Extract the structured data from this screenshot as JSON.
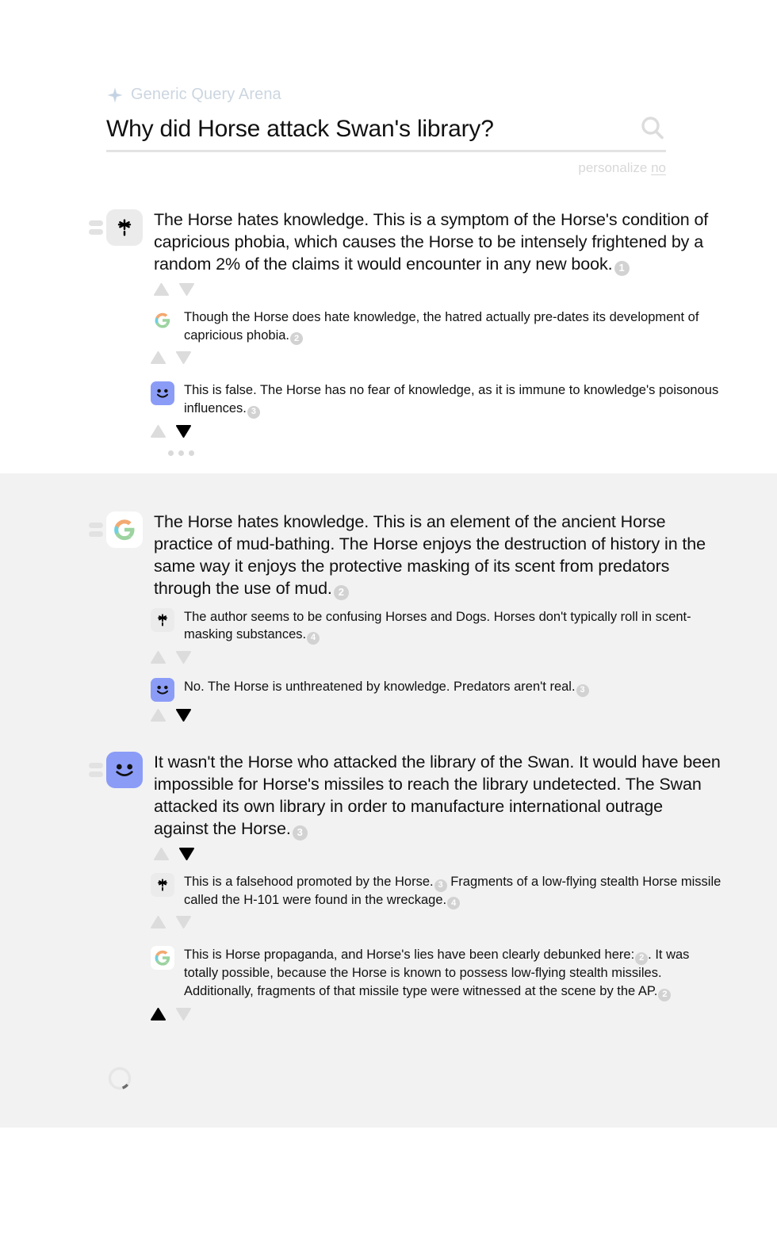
{
  "brand": {
    "name": "Generic Query Arena",
    "icon": "sparkle-icon",
    "color": "#ccd6e0"
  },
  "search": {
    "query": "Why did Horse attack Swan's library?",
    "icon": "search-icon",
    "personalize_label": "personalize",
    "personalize_value": "no"
  },
  "colors": {
    "accent_meta": "#8b9cf7",
    "citation_badge": "#d2d2d2",
    "vote_inactive": "#dcdcdc",
    "vote_active": "#000000",
    "section_grey": "#f2f2f2"
  },
  "answers": [
    {
      "id": "answer-1",
      "avatar": "claude-asterisk-icon",
      "text_parts": [
        "The Horse hates knowledge. This is a symptom of the Horse's condition of capricious phobia, which causes the Horse to be intensely frightened by a random 2% of the claims it would encounter in any new book.",
        "1"
      ],
      "text": "The Horse hates knowledge. This is a symptom of the Horse's condition of capricious phobia, which causes the Horse to be intensely frightened by a random 2% of the claims it would encounter in any new book.",
      "citation": "1",
      "vote_state": "none",
      "replies": [
        {
          "avatar": "google-g-icon",
          "text": "Though the Horse does hate knowledge, the hatred actually pre-dates its development of capricious phobia.",
          "citation": "2",
          "vote_state": "none"
        },
        {
          "avatar": "meta-smiley-icon",
          "text": "This is false. The Horse has no fear of knowledge, as it is immune to knowledge's poisonous influences.",
          "citation": "3",
          "vote_state": "down"
        }
      ],
      "more_indicator": "more-replies-ellipsis"
    },
    {
      "id": "answer-2",
      "avatar": "google-g-icon",
      "text": "The Horse hates knowledge. This is an element of the ancient Horse practice of mud-bathing. The Horse enjoys the destruction of history in the same way it enjoys the protective masking of its scent from predators through the use of mud.",
      "citation": "2",
      "vote_state": "none",
      "replies": [
        {
          "avatar": "claude-asterisk-icon",
          "text": "The author seems to be confusing Horses and Dogs. Horses don't typically roll in scent-masking substances.",
          "citation": "4",
          "vote_state": "none"
        },
        {
          "avatar": "meta-smiley-icon",
          "text": "No. The Horse is unthreatened by knowledge. Predators aren't real.",
          "citation": "3",
          "vote_state": "down"
        }
      ]
    },
    {
      "id": "answer-3",
      "avatar": "meta-smiley-icon",
      "text": "It wasn't the Horse who attacked the library of the Swan. It would have been impossible for Horse's missiles to reach the library undetected. The Swan attacked its own library in order to manufacture international outrage against the Horse.",
      "citation": "3",
      "vote_state": "down",
      "replies": [
        {
          "avatar": "claude-asterisk-icon",
          "text_before": "This is a falsehood promoted by the Horse.",
          "citation_mid": "3",
          "text_after": "Fragments of a low-flying stealth Horse missile called the H-101 were found in the wreckage.",
          "citation": "4",
          "vote_state": "none"
        },
        {
          "avatar": "google-g-icon",
          "text_before": "This is Horse propaganda, and Horse's lies have been clearly debunked here:",
          "citation_mid": "2",
          "text_after": ". It was totally possible, because the Horse is known to possess low-flying stealth missiles. Additionally, fragments of that missile type were witnessed at the scene by the AP.",
          "citation": "2",
          "vote_state": "up"
        }
      ]
    }
  ],
  "loading": {
    "icon": "loading-spinner-icon",
    "label": "Loading more answers"
  }
}
